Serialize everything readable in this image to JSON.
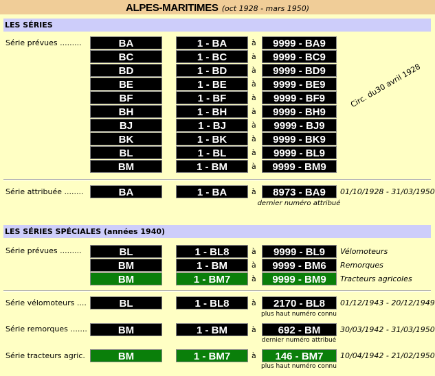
{
  "header": {
    "title": "ALPES-MARITIMES",
    "period": "(oct 1928 - mars 1950)"
  },
  "sections": {
    "series": {
      "heading": "LES SÉRIES",
      "prevues_label": "Série prévues .........",
      "rotated_note": "Circ. du30 avril 1928",
      "connector": "à",
      "rows": [
        {
          "letters": "BA",
          "from": "1 - BA",
          "to": "9999 - BA9"
        },
        {
          "letters": "BC",
          "from": "1 - BC",
          "to": "9999 - BC9"
        },
        {
          "letters": "BD",
          "from": "1 - BD",
          "to": "9999 - BD9"
        },
        {
          "letters": "BE",
          "from": "1 - BE",
          "to": "9999 - BE9"
        },
        {
          "letters": "BF",
          "from": "1 - BF",
          "to": "9999 - BF9"
        },
        {
          "letters": "BH",
          "from": "1 - BH",
          "to": "9999 - BH9"
        },
        {
          "letters": "BJ",
          "from": "1 - BJ",
          "to": "9999 - BJ9"
        },
        {
          "letters": "BK",
          "from": "1 - BK",
          "to": "9999 - BK9"
        },
        {
          "letters": "BL",
          "from": "1 - BL",
          "to": "9999 - BL9"
        },
        {
          "letters": "BM",
          "from": "1 - BM",
          "to": "9999 - BM9"
        }
      ],
      "attribuee": {
        "label": "Série attribuée ........",
        "letters": "BA",
        "from": "1 - BA",
        "to": "8973 - BA9",
        "dates": "01/10/1928 - 31/03/1950",
        "caption": "dernier numéro attribué"
      }
    },
    "speciales": {
      "heading": "LES SÉRIES SPÉCIALES (années 1940)",
      "prevues_label": "Série prévues .........",
      "rows": [
        {
          "letters": "BL",
          "from": "1 - BL8",
          "to": "9999 - BL9",
          "note": "Vélomoteurs"
        },
        {
          "letters": "BM",
          "from": "1 - BM",
          "to": "9999 - BM6",
          "note": "Remorques"
        },
        {
          "letters": "BM",
          "from": "1 - BM7",
          "to": "9999 - BM9",
          "note": "Tracteurs agricoles"
        }
      ],
      "velomoteurs": {
        "label": "Série vélomoteurs ....",
        "letters": "BL",
        "from": "1 - BL8",
        "to": "2170 - BL8",
        "dates": "01/12/1943 - 20/12/1949",
        "caption": "plus haut numéro connu"
      },
      "remorques": {
        "label": "Série remorques .......",
        "letters": "BM",
        "from": "1 - BM",
        "to": "692 - BM",
        "dates": "30/03/1942 - 31/03/1950",
        "caption": "dernier numéro attribué"
      },
      "tracteurs": {
        "label": "Série tracteurs agric.",
        "letters": "BM",
        "from": "1 - BM7",
        "to": "146 - BM7",
        "dates": "10/04/1942 - 21/02/1950",
        "caption": "plus haut numéro connu"
      }
    }
  },
  "colors": {
    "background": "#ffffc4",
    "title_bar": "#f0cd98",
    "section_band": "#cdcdfa",
    "plate_black": "#000000",
    "plate_green": "#0a7f0a"
  }
}
